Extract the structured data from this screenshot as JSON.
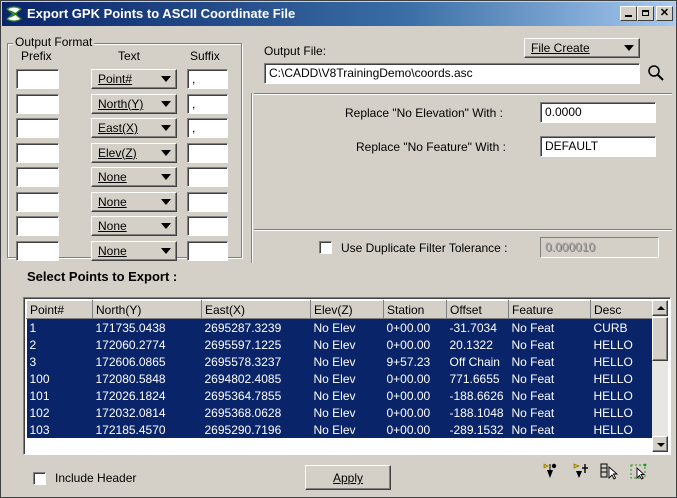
{
  "window": {
    "title": "Export GPK Points to ASCII Coordinate File"
  },
  "output_format": {
    "group_label": "Output Format",
    "col_prefix": "Prefix",
    "col_text": "Text",
    "col_suffix": "Suffix",
    "rows": [
      {
        "prefix": "",
        "text": "Point#",
        "suffix": ","
      },
      {
        "prefix": "",
        "text": "North(Y)",
        "suffix": ","
      },
      {
        "prefix": "",
        "text": "East(X)",
        "suffix": ","
      },
      {
        "prefix": "",
        "text": "Elev(Z)",
        "suffix": ""
      },
      {
        "prefix": "",
        "text": "None",
        "suffix": ""
      },
      {
        "prefix": "",
        "text": "None",
        "suffix": ""
      },
      {
        "prefix": "",
        "text": "None",
        "suffix": ""
      },
      {
        "prefix": "",
        "text": "None",
        "suffix": ""
      }
    ]
  },
  "output_file": {
    "label": "Output File:",
    "mode": "File Create",
    "path": "C:\\CADD\\V8TrainingDemo\\coords.asc"
  },
  "replace_elev": {
    "label": "Replace \"No Elevation\" With :",
    "value": "0.0000"
  },
  "replace_feat": {
    "label": "Replace \"No Feature\" With :",
    "value": "DEFAULT"
  },
  "dup_filter": {
    "label": "Use Duplicate Filter Tolerance :",
    "value": "0.000010",
    "checked": false
  },
  "select_label": "Select Points to Export :",
  "table": {
    "headers": [
      "Point#",
      "North(Y)",
      "East(X)",
      "Elev(Z)",
      "Station",
      "Offset",
      "Feature",
      "Desc"
    ],
    "rows": [
      [
        "1",
        "171735.0438",
        "2695287.3239",
        "No Elev",
        "0+00.00",
        "-31.7034",
        "No Feat",
        "CURB"
      ],
      [
        "2",
        "172060.2774",
        "2695597.1225",
        "No Elev",
        "0+00.00",
        "20.1322",
        "No Feat",
        "HELLO"
      ],
      [
        "3",
        "172606.0865",
        "2695578.3237",
        "No Elev",
        "9+57.23",
        "Off Chain",
        "No Feat",
        "HELLO"
      ],
      [
        "100",
        "172080.5848",
        "2694802.4085",
        "No Elev",
        "0+00.00",
        "771.6655",
        "No Feat",
        "HELLO"
      ],
      [
        "101",
        "172026.1824",
        "2695364.7855",
        "No Elev",
        "0+00.00",
        "-188.6626",
        "No Feat",
        "HELLO"
      ],
      [
        "102",
        "172032.0814",
        "2695368.0628",
        "No Elev",
        "0+00.00",
        "-188.1048",
        "No Feat",
        "HELLO"
      ],
      [
        "103",
        "172185.4570",
        "2695290.7196",
        "No Elev",
        "0+00.00",
        "-289.1532",
        "No Feat",
        "HELLO"
      ]
    ]
  },
  "include_header": {
    "label": "Include Header",
    "checked": false
  },
  "apply_label": "Apply",
  "colors": {
    "title_start": "#0a246a",
    "selection": "#0a246a",
    "face": "#d4d0c8"
  }
}
